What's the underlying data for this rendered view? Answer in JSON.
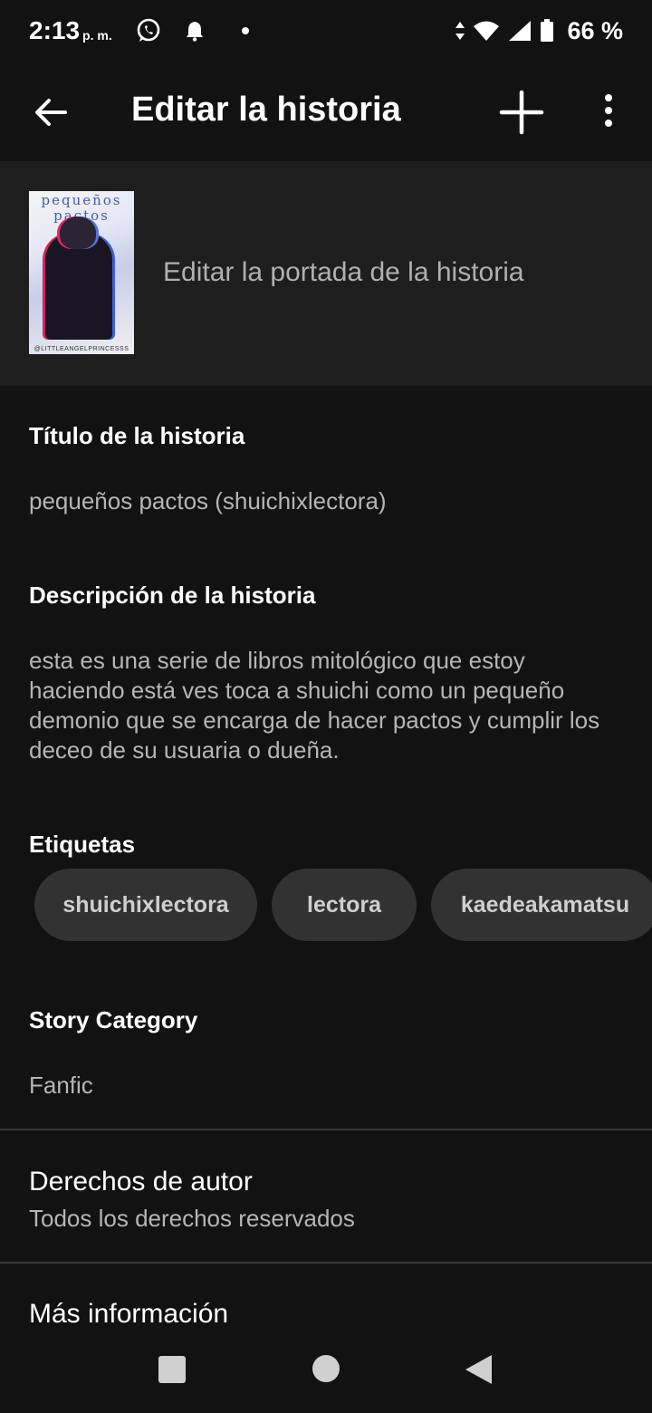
{
  "status_bar": {
    "time": "2:13",
    "ampm": "p. m.",
    "battery": "66 %"
  },
  "app_bar": {
    "title": "Editar la historia"
  },
  "cover": {
    "title_line1": "pequeños",
    "title_line2": "pactos",
    "author_text": "@LITTLEANGELPRINCESSS",
    "edit_label": "Editar la portada de la historia"
  },
  "story": {
    "title_label": "Título de la historia",
    "title_value": "pequeños pactos (shuichixlectora)",
    "description_label": "Descripción de la historia",
    "description_value": "esta es una serie de libros mitológico que estoy haciendo está ves toca a shuichi como un pequeño demonio que se encarga de hacer pactos y cumplir los deceo de su usuaria o dueña.",
    "tags_label": "Etiquetas",
    "tags": [
      "shuichixlectora",
      "lectora",
      "kaedeakamatsu"
    ],
    "category_label": "Story Category",
    "category_value": "Fanfic"
  },
  "copyright": {
    "title": "Derechos de autor",
    "value": "Todos los derechos reservados"
  },
  "more_info": {
    "title": "Más información"
  },
  "colors": {
    "background": "#121212",
    "cover_section": "#1e1e1e",
    "tag_bg": "#323232",
    "secondary_text": "#b5b5b5"
  }
}
